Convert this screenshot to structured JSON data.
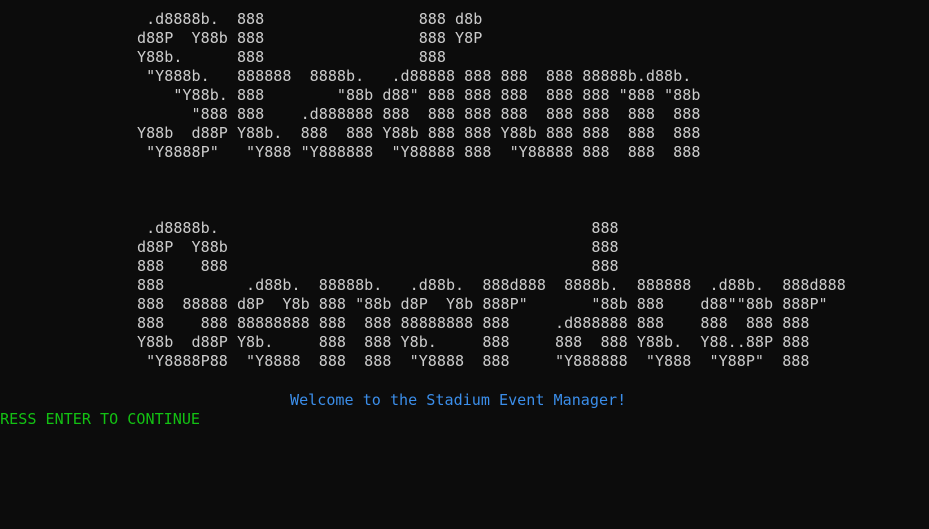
{
  "banner_top": [
    " .d8888b.  888                 888 d8b",
    "d88P  Y88b 888                 888 Y8P",
    "Y88b.      888                 888",
    " \"Y888b.   888888  8888b.   .d88888 888 888  888 88888b.d88b.",
    "    \"Y88b. 888        \"88b d88\" 888 888 888  888 888 \"888 \"88b",
    "      \"888 888    .d888888 888  888 888 888  888 888  888  888",
    "Y88b  d88P Y88b.  888  888 Y88b 888 888 Y88b 888 888  888  888",
    " \"Y8888P\"   \"Y888 \"Y888888  \"Y88888 888  \"Y88888 888  888  888"
  ],
  "banner_bottom": [
    " .d8888b.                                         888",
    "d88P  Y88b                                        888",
    "888    888                                        888",
    "888         .d88b.  88888b.   .d88b.  888d888  8888b.  888888  .d88b.  888d888",
    "888  88888 d8P  Y8b 888 \"88b d8P  Y8b 888P\"       \"88b 888    d88\"\"88b 888P\"",
    "888    888 88888888 888  888 88888888 888     .d888888 888    888  888 888",
    "Y88b  d88P Y8b.     888  888 Y8b.     888     888  888 Y88b.  Y88..88P 888",
    " \"Y8888P88  \"Y8888  888  888  \"Y8888  888     \"Y888888  \"Y888  \"Y88P\"  888"
  ],
  "welcome_message": "Welcome to the Stadium Event Manager!",
  "continue_prompt": "PRESS ENTER TO CONTINUE",
  "colors": {
    "background": "#0c0c0c",
    "ascii_art": "#cccccc",
    "welcome": "#3b8eea",
    "prompt": "#13c113"
  }
}
